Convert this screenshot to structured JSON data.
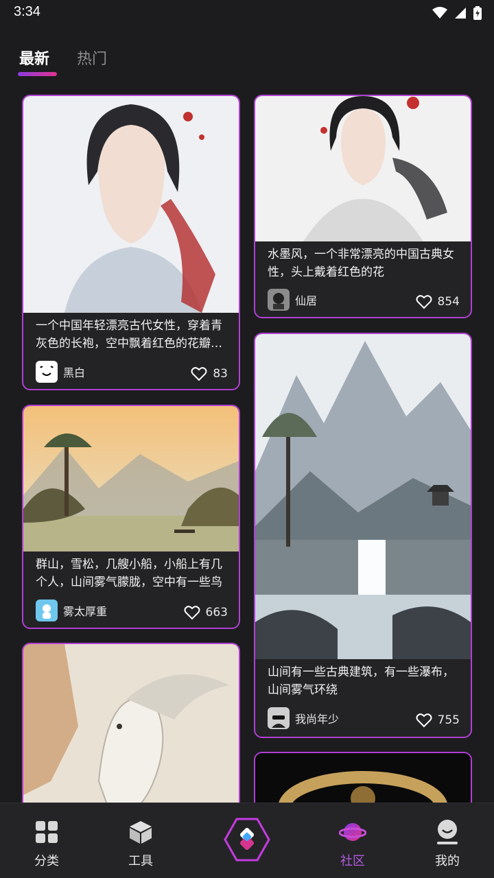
{
  "status": {
    "time": "3:34"
  },
  "tabs": {
    "latest": "最新",
    "hot": "热门"
  },
  "cards": [
    {
      "text": "一个中国年轻漂亮古代女性，穿着青灰色的长袍，空中飘着红色的花瓣…",
      "user": "黑白",
      "likes": "83"
    },
    {
      "text": "水墨风，一个非常漂亮的中国古典女性，头上戴着红色的花",
      "user": "仙居",
      "likes": "854"
    },
    {
      "text": "群山，雪松，几艘小船，小船上有几个人，山间雾气朦胧，空中有一些鸟",
      "user": "雾太厚重",
      "likes": "663"
    },
    {
      "text": "山间有一些古典建筑，有一些瀑布，山间雾气环绕",
      "user": "我尚年少",
      "likes": "755"
    }
  ],
  "nav": {
    "category": "分类",
    "tools": "工具",
    "community": "社区",
    "mine": "我的"
  },
  "colors": {
    "accent": "#b35be0",
    "border": "#b13fd4",
    "background": "#1c1c1e"
  }
}
